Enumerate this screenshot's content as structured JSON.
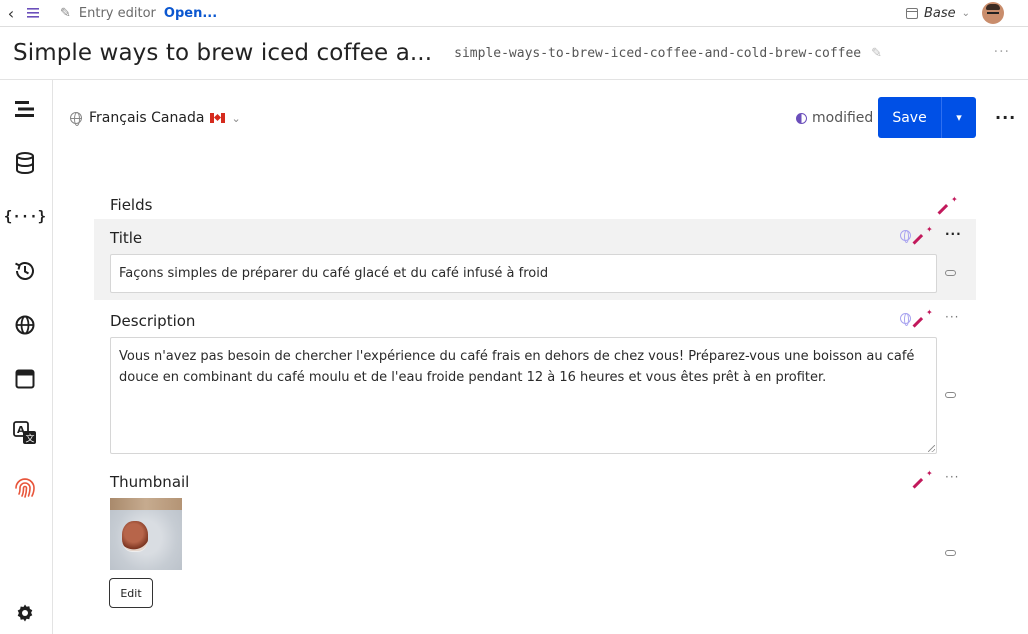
{
  "topbar": {
    "breadcrumb_title": "Entry editor",
    "open_link": "Open...",
    "workspace": "Base"
  },
  "header": {
    "entry_title": "Simple ways to brew iced coffee a...",
    "slug": "simple-ways-to-brew-iced-coffee-and-cold-brew-coffee"
  },
  "sidebar": {
    "items": [
      "content-icon",
      "database-icon",
      "code-icon",
      "history-icon",
      "globe-icon",
      "layout-icon",
      "translate-icon",
      "fingerprint-icon",
      "settings-icon"
    ]
  },
  "locale": {
    "label": "Français Canada",
    "flag": "canada-flag-icon"
  },
  "status": {
    "label": "modified"
  },
  "actions": {
    "save_label": "Save"
  },
  "fields": {
    "heading": "Fields",
    "title": {
      "label": "Title",
      "value": "Façons simples de préparer du café glacé et du café infusé à froid"
    },
    "description": {
      "label": "Description",
      "value": "Vous n'avez pas besoin de chercher l'expérience du café frais en dehors de chez vous! Préparez-vous une boisson au café douce en combinant du café moulu et de l'eau froide pendant 12 à 16 heures et vous êtes prêt à en profiter."
    },
    "thumbnail": {
      "label": "Thumbnail",
      "edit_label": "Edit"
    }
  },
  "colors": {
    "primary": "#0050e6",
    "accent_wand": "#c2185b",
    "link": "#0b57d0"
  }
}
